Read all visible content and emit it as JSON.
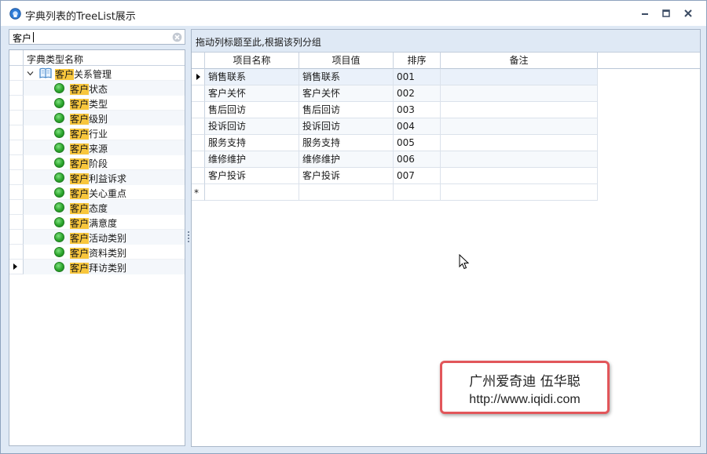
{
  "window": {
    "title": "字典列表的TreeList展示",
    "controls": [
      "minimize-icon",
      "maximize-icon",
      "close-icon"
    ]
  },
  "left": {
    "search": {
      "value": "客户",
      "clear_icon": "clear-icon"
    },
    "tree_header": "字典类型名称",
    "root": {
      "highlight": "客户",
      "rest": "关系管理",
      "icon": "book-icon",
      "expanded": true
    },
    "children": [
      {
        "highlight": "客户",
        "rest": "状态"
      },
      {
        "highlight": "客户",
        "rest": "类型"
      },
      {
        "highlight": "客户",
        "rest": "级别"
      },
      {
        "highlight": "客户",
        "rest": "行业"
      },
      {
        "highlight": "客户",
        "rest": "来源"
      },
      {
        "highlight": "客户",
        "rest": "阶段"
      },
      {
        "highlight": "客户",
        "rest": "利益诉求"
      },
      {
        "highlight": "客户",
        "rest": "关心重点"
      },
      {
        "highlight": "客户",
        "rest": "态度"
      },
      {
        "highlight": "客户",
        "rest": "满意度"
      },
      {
        "highlight": "客户",
        "rest": "活动类别"
      },
      {
        "highlight": "客户",
        "rest": "资料类别"
      },
      {
        "highlight": "客户",
        "rest": "拜访类别"
      }
    ],
    "highlight_color": "#f8c63c",
    "node_icon": "green-dot-icon"
  },
  "right": {
    "group_panel_text": "拖动列标题至此,根据该列分组",
    "columns": [
      "项目名称",
      "项目值",
      "排序",
      "备注"
    ],
    "rows": [
      [
        "销售联系",
        "销售联系",
        "001",
        ""
      ],
      [
        "客户关怀",
        "客户关怀",
        "002",
        ""
      ],
      [
        "售后回访",
        "售后回访",
        "003",
        ""
      ],
      [
        "投诉回访",
        "投诉回访",
        "004",
        ""
      ],
      [
        "服务支持",
        "服务支持",
        "005",
        ""
      ],
      [
        "维修维护",
        "维修维护",
        "006",
        ""
      ],
      [
        "客户投诉",
        "客户投诉",
        "007",
        ""
      ]
    ],
    "new_row_marker": "*"
  },
  "watermark": {
    "line1": "广州爱奇迪  伍华聪",
    "line2": "http://www.iqidi.com",
    "border_color": "#e2565a"
  }
}
